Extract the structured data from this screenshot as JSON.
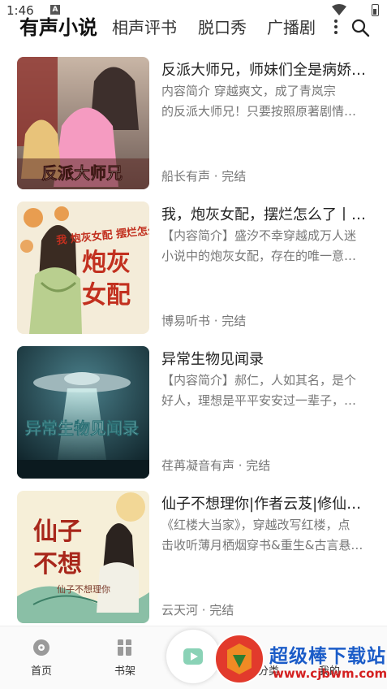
{
  "status_bar": {
    "time": "1:46",
    "notif_glyph": "A"
  },
  "tabs": [
    {
      "label": "有声小说",
      "active": true
    },
    {
      "label": "相声评书",
      "active": false
    },
    {
      "label": "脱口秀",
      "active": false
    },
    {
      "label": "广播剧",
      "active": false
    }
  ],
  "icons": {
    "menu": "menu-dots-icon",
    "search": "search-icon"
  },
  "books": [
    {
      "title": "反派大师兄，师妹们全是病娇…",
      "desc_line1": "内容简介 穿越爽文，成了青岚宗",
      "desc_line2": "的反派大师兄！只要按照原著剧情…",
      "meta": "船长有声 · 完结",
      "cover_text": "反派大师兄"
    },
    {
      "title": "我，炮灰女配，摆烂怎么了丨…",
      "desc_line1": "【内容简介】盛汐不幸穿越成万人迷",
      "desc_line2": "小说中的炮灰女配，存在的唯一意…",
      "meta": "博易听书 · 完结",
      "cover_text": "我 炮灰女配 摆烂怎么了"
    },
    {
      "title": "异常生物见闻录",
      "desc_line1": "【内容简介】郝仁，人如其名，是个",
      "desc_line2": "好人，理想是平平安安过一辈子，…",
      "meta": "荏苒凝音有声 · 完结",
      "cover_text": "异常生物见闻录"
    },
    {
      "title": "仙子不想理你|作者云芨|修仙…",
      "desc_line1": "《红楼大当家》，穿越改写红楼，点",
      "desc_line2": "击收听薄月栖烟穿书&重生&古言悬…",
      "meta": "云天河 · 完结",
      "cover_text": "仙子不想理你"
    }
  ],
  "bottom_nav": {
    "home": "首页",
    "shelf": "书架",
    "category": "分类",
    "me": "我的"
  },
  "watermark": {
    "title": "超级棒下载站",
    "url": "www.cjbwm.com"
  },
  "colors": {
    "accent": "#2ab07a",
    "watermark_blue": "#1b5cc8",
    "watermark_red": "#d42020"
  }
}
